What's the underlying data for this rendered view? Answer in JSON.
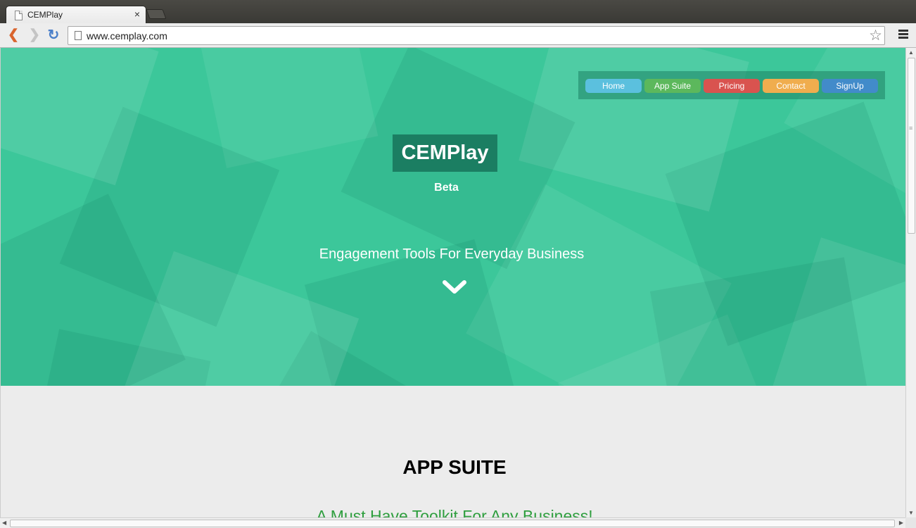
{
  "browser": {
    "tab_title": "CEMPlay",
    "tab_close": "×",
    "url": "www.cemplay.com",
    "icons": [
      "back-icon",
      "forward-icon",
      "reload-icon",
      "page-icon",
      "star-icon",
      "menu-icon"
    ]
  },
  "site": {
    "nav": [
      "Home",
      "App Suite",
      "Pricing",
      "Contact",
      "SignUp"
    ],
    "nav_colors": [
      "#5bc0de",
      "#5cb85c",
      "#d9534f",
      "#f0ad4e",
      "#428bca"
    ],
    "logo": "CEMPlay",
    "badge": "Beta",
    "tagline": "Engagement Tools For Everyday Business",
    "hero_color": "#3cc79a"
  },
  "section": {
    "title": "APP SUITE",
    "subtitle": "A Must Have Toolkit For Any Business!"
  }
}
